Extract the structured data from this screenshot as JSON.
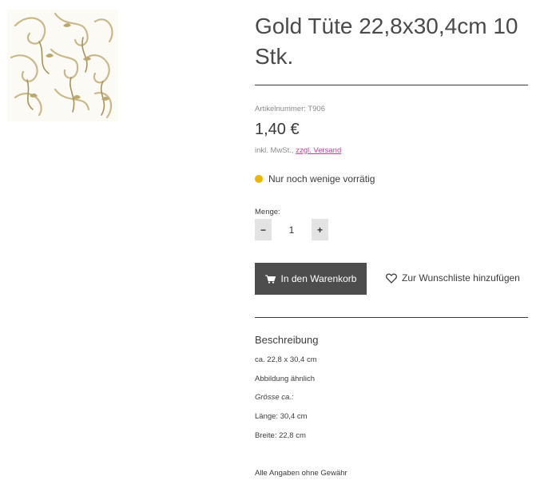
{
  "product": {
    "title": "Gold Tüte 22,8x30,4cm 10 Stk.",
    "sku": "Artikelnummer: T906",
    "price": "1,40 €",
    "tax_prefix": "inkl. MwSt.,",
    "tax_link": "zzgl. Versand",
    "stock": "Nur noch wenige vorrätig",
    "image_icon": "gold-swirl-pattern-image"
  },
  "quantity": {
    "label": "Menge:",
    "value": "1",
    "minus": "−",
    "plus": "+"
  },
  "actions": {
    "cart_label": "In den Warenkorb",
    "cart_icon": "shopping-cart-icon",
    "wishlist_label": "Zur Wunschliste hinzufügen",
    "wishlist_icon": "heart-icon"
  },
  "description": {
    "heading": "Beschreibung",
    "lines": [
      "ca. 22,8 x 30,4 cm",
      "Abbildung ähnlich",
      "Grösse ca.:",
      "Länge: 30,4 cm",
      "Breite: 22,8 cm",
      "Alle Angaben ohne Gewähr"
    ]
  },
  "colors": {
    "stock_dot": "#f0b400",
    "cart_button": "#4d4d4d",
    "link": "#c0439a"
  }
}
